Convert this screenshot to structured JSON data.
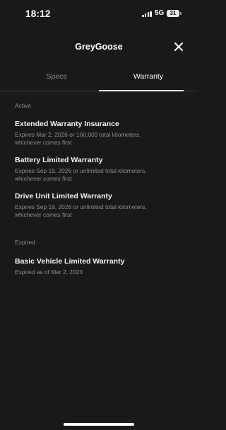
{
  "status_bar": {
    "time": "18:12",
    "network": "5G",
    "battery": "31"
  },
  "header": {
    "title": "GreyGoose",
    "close_icon": "close-icon"
  },
  "tabs": [
    {
      "label": "Specs",
      "active": false
    },
    {
      "label": "Warranty",
      "active": true
    }
  ],
  "sections": {
    "active": {
      "label": "Active",
      "items": [
        {
          "title": "Extended Warranty Insurance",
          "line1": "Expires Mar 2, 2026 or 160,009 total kilometers,",
          "line2": "whichever comes first"
        },
        {
          "title": "Battery Limited Warranty",
          "line1": "Expires Sep 19, 2026 or unlimited total kilometers,",
          "line2": "whichever comes first"
        },
        {
          "title": "Drive Unit Limited Warranty",
          "line1": "Expires Sep 19, 2026 or unlimited total kilometers,",
          "line2": "whichever comes first"
        }
      ]
    },
    "expired": {
      "label": "Expired",
      "items": [
        {
          "title": "Basic Vehicle Limited Warranty",
          "line1": "Expired as of Mar 2, 2023"
        }
      ]
    }
  },
  "colors": {
    "background": "#19191a",
    "primary_text": "#ffffff",
    "secondary_text": "#8b8b8d",
    "divider": "#3a3a3b"
  }
}
